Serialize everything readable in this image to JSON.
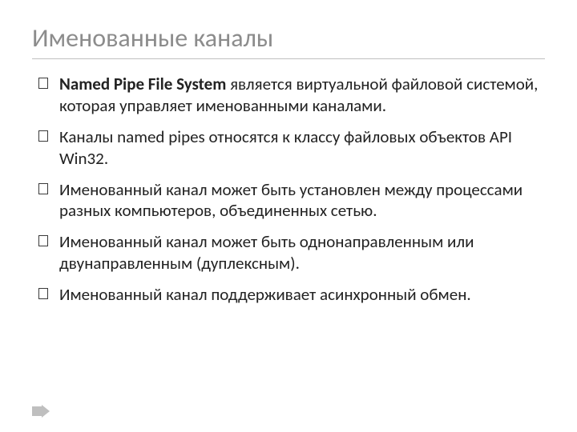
{
  "title": "Именованные каналы",
  "bullets": [
    {
      "bold": "Named Pipe File System",
      "rest": " является виртуальной файловой системой, которая управляет именованными каналами."
    },
    {
      "bold": "",
      "rest": "Каналы named pipes относятся к классу файловых объектов API Win32."
    },
    {
      "bold": "",
      "rest": "Именованный канал может быть установлен между процессами разных компьютеров, объединенных сетью."
    },
    {
      "bold": "",
      "rest": "Именованный канал может быть однонаправленным или двунаправленным (дуплексным)."
    },
    {
      "bold": "",
      "rest": "Именованный канал поддерживает асинхронный обмен."
    }
  ]
}
